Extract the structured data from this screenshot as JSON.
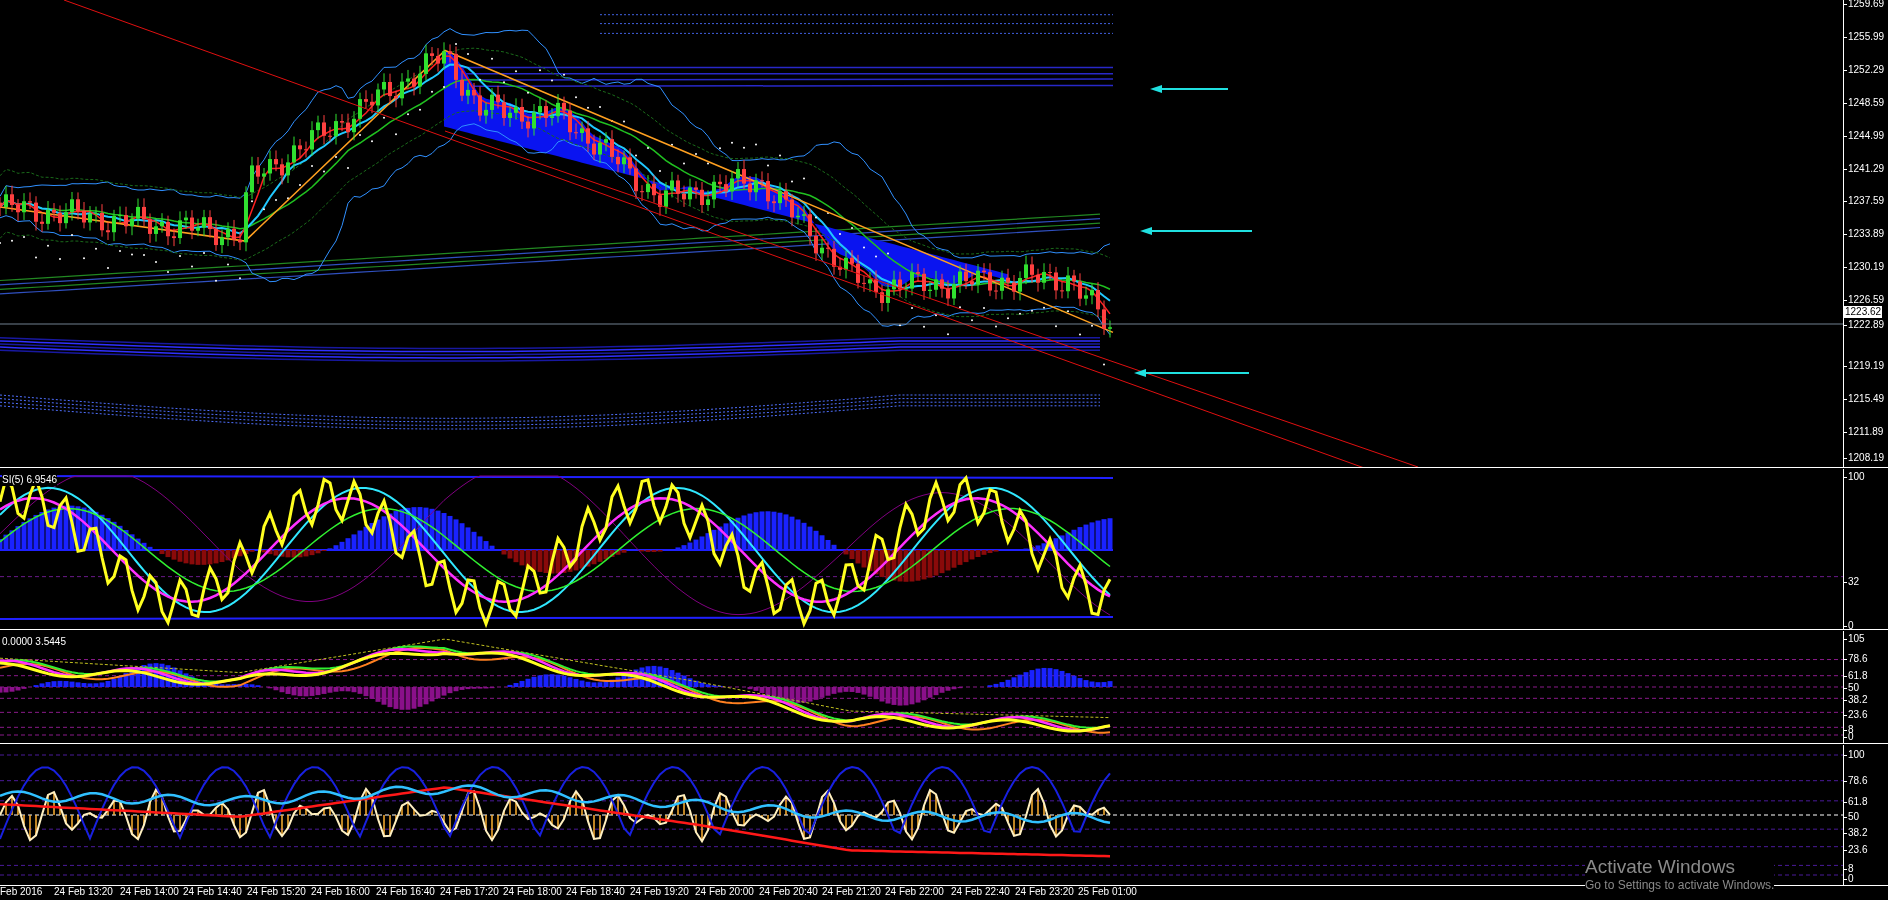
{
  "main_chart": {
    "price_labels": [
      "1259.69",
      "1255.99",
      "1252.29",
      "1248.59",
      "1244.99",
      "1241.29",
      "1237.59",
      "1233.89",
      "1230.19",
      "1226.59",
      "1222.89",
      "1219.19",
      "1215.49",
      "1211.89",
      "1208.19"
    ],
    "current_price": "1223.62"
  },
  "indicator_panels": [
    {
      "kind": "rsi",
      "label": "SI(5) 6.9546",
      "scale_labels": [
        "100",
        "32",
        "0"
      ]
    },
    {
      "kind": "stoch",
      "label": "0.0000 3.5445",
      "scale_labels": [
        "105",
        "78.6",
        "61.8",
        "50",
        "38.2",
        "23.6",
        "8",
        "0"
      ]
    },
    {
      "kind": "osc",
      "scale_labels": [
        "100",
        "78.6",
        "61.8",
        "50",
        "38.2",
        "23.6",
        "8",
        "0"
      ]
    }
  ],
  "time_axis": [
    "Feb 2016",
    "24 Feb 13:20",
    "24 Feb 14:00",
    "24 Feb 14:40",
    "24 Feb 15:20",
    "24 Feb 16:00",
    "24 Feb 16:40",
    "24 Feb 17:20",
    "24 Feb 18:00",
    "24 Feb 18:40",
    "24 Feb 19:20",
    "24 Feb 20:00",
    "24 Feb 20:40",
    "24 Feb 21:20",
    "24 Feb 22:00",
    "24 Feb 22:40",
    "24 Feb 23:20",
    "25 Feb 01:00"
  ],
  "activation_notice": {
    "title": "Activate Windows",
    "subtitle": "Go to Settings to activate Windows."
  }
}
